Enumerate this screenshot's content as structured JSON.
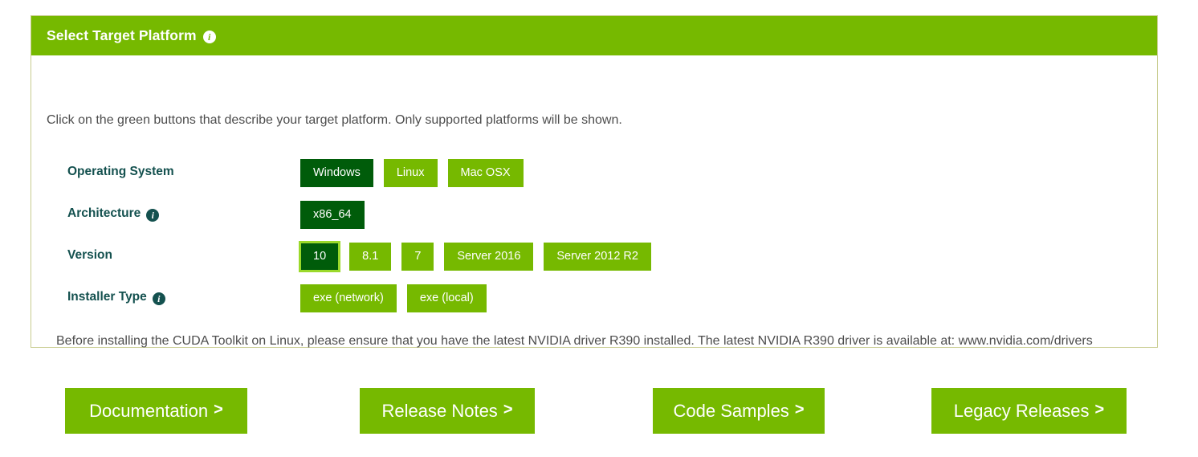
{
  "panel": {
    "header_title": "Select Target Platform",
    "header_info_icon": "info-icon",
    "intro_text": "Click on the green buttons that describe your target platform. Only supported platforms will be shown.",
    "note_text": "Before installing the CUDA Toolkit on Linux, please ensure that you have the latest NVIDIA driver R390 installed. The latest NVIDIA R390 driver is available at: www.nvidia.com/drivers"
  },
  "rows": {
    "os": {
      "label": "Operating System",
      "options": [
        {
          "label": "Windows",
          "state": "selected"
        },
        {
          "label": "Linux",
          "state": "normal"
        },
        {
          "label": "Mac OSX",
          "state": "normal"
        }
      ]
    },
    "architecture": {
      "label": "Architecture",
      "info_icon": "info-icon",
      "options": [
        {
          "label": "x86_64",
          "state": "selected"
        }
      ]
    },
    "version": {
      "label": "Version",
      "options": [
        {
          "label": "10",
          "state": "focused"
        },
        {
          "label": "8.1",
          "state": "normal"
        },
        {
          "label": "7",
          "state": "normal"
        },
        {
          "label": "Server 2016",
          "state": "normal"
        },
        {
          "label": "Server 2012 R2",
          "state": "normal"
        }
      ]
    },
    "installer_type": {
      "label": "Installer Type",
      "info_icon": "info-icon",
      "options": [
        {
          "label": "exe (network)",
          "state": "normal"
        },
        {
          "label": "exe (local)",
          "state": "normal"
        }
      ]
    }
  },
  "bottom_buttons": [
    {
      "label": "Documentation",
      "chevron": ">"
    },
    {
      "label": "Release Notes",
      "chevron": ">"
    },
    {
      "label": "Code Samples",
      "chevron": ">"
    },
    {
      "label": "Legacy Releases",
      "chevron": ">"
    }
  ],
  "colors": {
    "brand_green": "#76b900",
    "selected_green": "#005c0a",
    "focus_ring": "#9bd92b",
    "label_teal": "#14514f",
    "panel_border": "#c8cc8e",
    "body_text": "#4d4d4d"
  }
}
